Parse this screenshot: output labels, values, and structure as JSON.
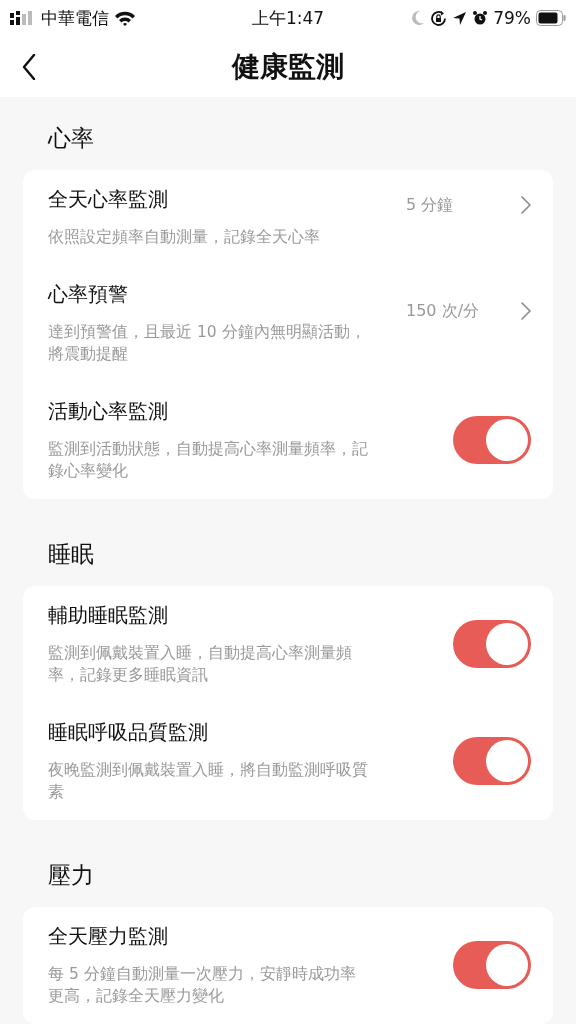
{
  "status_bar": {
    "carrier": "中華電信",
    "time": "上午1:47",
    "battery": "79%"
  },
  "nav": {
    "title": "健康監測"
  },
  "sections": [
    {
      "title": "心率",
      "rows": [
        {
          "kind": "value",
          "title": "全天心率監測",
          "description": "依照設定頻率自動測量，記錄全天心率",
          "value": "5 分鐘"
        },
        {
          "kind": "value",
          "title": "心率預警",
          "description": "達到預警值，且最近 10 分鐘內無明顯活動，將震動提醒",
          "value": "150 次/分"
        },
        {
          "kind": "toggle",
          "title": "活動心率監測",
          "description": "監測到活動狀態，自動提高心率測量頻率，記錄心率變化",
          "on": true
        }
      ]
    },
    {
      "title": "睡眠",
      "rows": [
        {
          "kind": "toggle",
          "title": "輔助睡眠監測",
          "description": "監測到佩戴裝置入睡，自動提高心率測量頻率，記錄更多睡眠資訊",
          "on": true
        },
        {
          "kind": "toggle",
          "title": "睡眠呼吸品質監測",
          "description": "夜晚監測到佩戴裝置入睡，將自動監測呼吸質素",
          "on": true
        }
      ]
    },
    {
      "title": "壓力",
      "rows": [
        {
          "kind": "toggle",
          "title": "全天壓力監測",
          "description": "每 5 分鐘自動測量一次壓力，安靜時成功率更高，記錄全天壓力變化",
          "on": true
        }
      ]
    }
  ]
}
